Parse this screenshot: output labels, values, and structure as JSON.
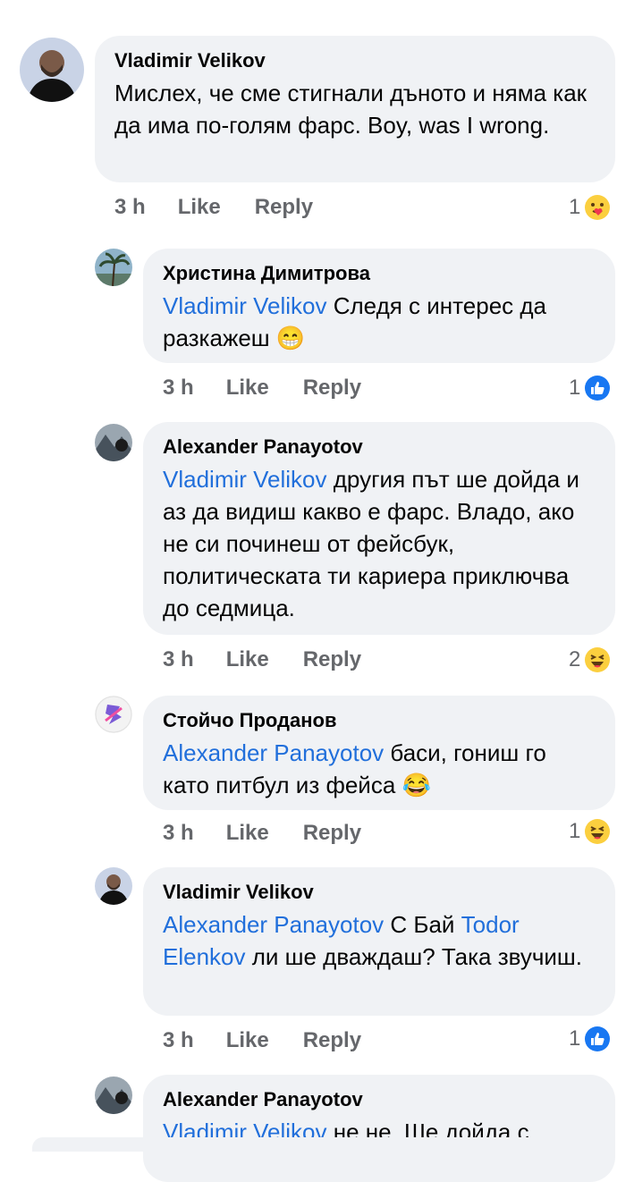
{
  "comments": [
    {
      "author": "Vladimir Velikov",
      "mention": "",
      "text": "Мислех, че сме стигнали дъното и няма как да има по-голям фарс. Boy, was I wrong.",
      "time": "3 h",
      "like": "Like",
      "reply": "Reply",
      "reaction_count": "1",
      "reaction": "care-icon"
    },
    {
      "author": "Христина Димитрова",
      "mention": "Vladimir Velikov",
      "text": " Следя с интерес да разкажеш 😁",
      "time": "3 h",
      "like": "Like",
      "reply": "Reply",
      "reaction_count": "1",
      "reaction": "like-icon"
    },
    {
      "author": "Alexander Panayotov",
      "mention": "Vladimir Velikov",
      "text": " другия път ше дойда и аз да видиш какво е фарс. Владо, ако не си починеш от фейсбук, политическата ти кариера приключва до седмица.",
      "time": "3 h",
      "like": "Like",
      "reply": "Reply",
      "reaction_count": "2",
      "reaction": "haha-icon"
    },
    {
      "author": "Стойчо Проданов",
      "mention": "Alexander Panayotov",
      "text": " баси, гониш го като питбул из фейса 😂",
      "time": "3 h",
      "like": "Like",
      "reply": "Reply",
      "reaction_count": "1",
      "reaction": "haha-icon"
    },
    {
      "author": "Vladimir Velikov",
      "mention": "Alexander Panayotov",
      "text_middle": " С Бай ",
      "mention2": "Todor Elenkov",
      "text": " ли ше дваждаш? Така звучиш.",
      "time": "3 h",
      "like": "Like",
      "reply": "Reply",
      "reaction_count": "1",
      "reaction": "like-icon"
    },
    {
      "author": "Alexander Panayotov",
      "mention": "Vladimir Velikov",
      "text": " не не. Ше дойда с"
    }
  ],
  "colors": {
    "mention": "#216fdb",
    "bubble": "#f0f2f5",
    "meta": "#65676b",
    "like_blue": "#1877f2",
    "emoji_yellow": "#fbcf3f"
  }
}
